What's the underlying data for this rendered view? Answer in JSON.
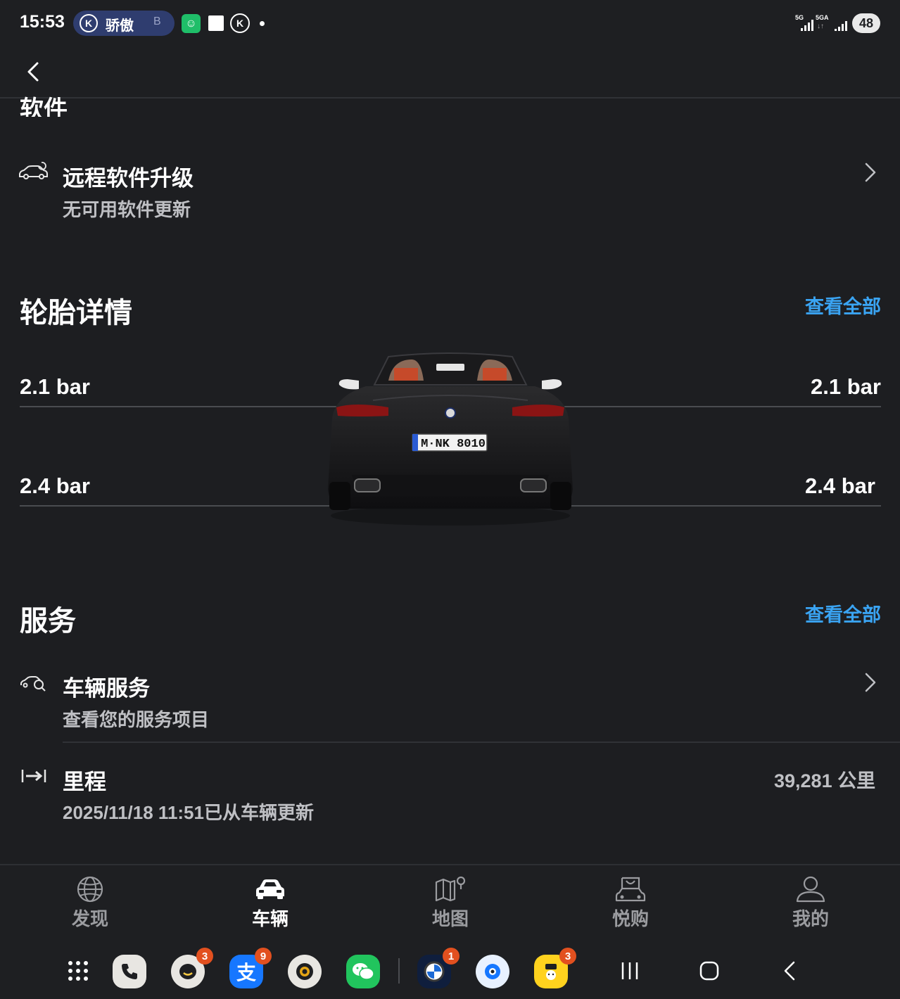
{
  "status_bar": {
    "time": "15:53",
    "notif_pill_text": "骄傲",
    "notif_pill_suffix": "B",
    "signal_1": "5G",
    "signal_2": "5GA",
    "battery": "48"
  },
  "header": {
    "back_icon": "chevron-left-icon"
  },
  "software": {
    "section_title": "软件",
    "remote_upgrade": {
      "title": "远程软件升级",
      "subtitle": "无可用软件更新",
      "icon": "car-update-icon"
    }
  },
  "tires": {
    "section_title": "轮胎详情",
    "view_all": "查看全部",
    "front_left": "2.1 bar",
    "front_right": "2.1 bar",
    "rear_left": "2.4 bar",
    "rear_right": "2.4 bar",
    "license_plate": "M·NK 8010"
  },
  "service": {
    "section_title": "服务",
    "view_all": "查看全部",
    "vehicle_service": {
      "title": "车辆服务",
      "subtitle": "查看您的服务项目",
      "icon": "car-service-icon"
    },
    "mileage": {
      "title": "里程",
      "subtitle": "2025/11/18 11:51已从车辆更新",
      "value": "39,281 公里",
      "icon": "distance-icon"
    }
  },
  "bottom_nav": {
    "items": [
      {
        "label": "发现",
        "icon": "globe-icon",
        "active": false
      },
      {
        "label": "车辆",
        "icon": "car-icon",
        "active": true
      },
      {
        "label": "地图",
        "icon": "map-icon",
        "active": false
      },
      {
        "label": "悦购",
        "icon": "shop-car-icon",
        "active": false
      },
      {
        "label": "我的",
        "icon": "person-icon",
        "active": false
      }
    ]
  },
  "dock": {
    "badges": {
      "chat_app": "3",
      "alipay": "9",
      "bmw": "1",
      "meituan": "3"
    },
    "alipay_glyph": "支"
  },
  "colors": {
    "background": "#1d1e21",
    "accent_link": "#3aa4f3",
    "badge": "#e2501f"
  }
}
